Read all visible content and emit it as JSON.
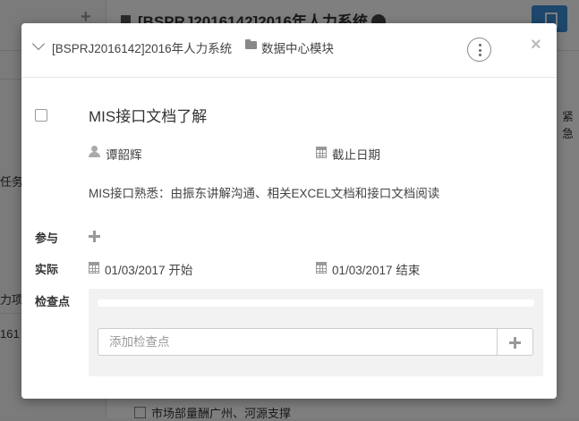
{
  "background": {
    "project_title": "[BSPRJ2016142]2016年人力系统",
    "left_fragments": [
      "任务",
      "力项",
      "161"
    ],
    "right_fragment": "紧急",
    "bottom_task": "市场部量酬广州、河源支撑"
  },
  "header": {
    "project": "[BSPRJ2016142]2016年人力系统",
    "module": "数据中心模块",
    "close_symbol": "×"
  },
  "task": {
    "title": "MIS接口文档了解",
    "assignee": "谭韶辉",
    "due_date_label": "截止日期",
    "description": "MIS接口熟悉：由振东讲解沟通、相关EXCEL文档和接口文档阅读"
  },
  "labels": {
    "participants": "参与",
    "actual": "实际",
    "checkpoints": "检查点"
  },
  "actual": {
    "start": "01/03/2017 开始",
    "end": "01/03/2017 结束"
  },
  "checklist": {
    "placeholder": "添加检查点",
    "progress": 0
  },
  "icons": {
    "header_collapse": "chevron-down-icon",
    "module": "folder-icon",
    "more": "more-vertical-icon",
    "assignee": "user-icon",
    "calendar": "calendar-icon",
    "add": "plus-icon"
  }
}
